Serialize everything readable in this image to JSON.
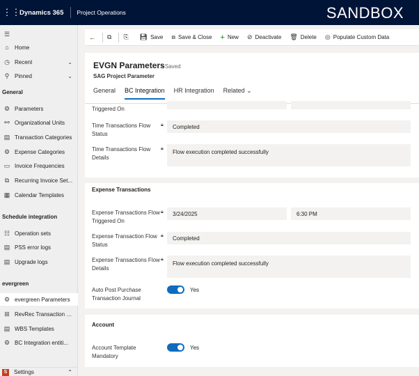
{
  "topbar": {
    "app_name": "Dynamics 365",
    "area": "Project Operations",
    "env": "SANDBOX"
  },
  "sidebar": {
    "nav": [
      {
        "label": "Home",
        "icon": "home-icon"
      },
      {
        "label": "Recent",
        "icon": "clock-icon"
      },
      {
        "label": "Pinned",
        "icon": "pin-icon"
      }
    ],
    "groups": [
      {
        "title": "General",
        "items": [
          "Parameters",
          "Organizational Units",
          "Transaction Categories",
          "Expense Categories",
          "Invoice Frequencies",
          "Recurring Invoice Set...",
          "Calendar Templates"
        ]
      },
      {
        "title": "Schedule integration",
        "items": [
          "Operation sets",
          "PSS error logs",
          "Upgrade logs"
        ]
      },
      {
        "title": "evergreen",
        "items": [
          "evergreen Parameters",
          "RevRec Transaction C...",
          "WBS Templates",
          "BC Integration entiti..."
        ]
      }
    ],
    "settings": {
      "badge": "S",
      "label": "Settings"
    }
  },
  "commands": [
    "Save",
    "Save & Close",
    "New",
    "Deactivate",
    "Delete",
    "Populate Custom Data"
  ],
  "header": {
    "title": "EVGN Parameters",
    "status": "- Saved",
    "subtitle": "SAG Project Parameter",
    "tabs": [
      "General",
      "BC Integration",
      "HR Integration",
      "Related"
    ]
  },
  "time_section": {
    "partial_label": "Triggered On",
    "status_label": "Time Transactions Flow Status",
    "status_value": "Completed",
    "details_label": "Time Transactions Flow Details",
    "details_value": "Flow execution completed successfully"
  },
  "expense_section": {
    "title": "Expense Transactions",
    "triggered_label": "Expense Transactions Flow Triggered On",
    "date_value": "3/24/2025",
    "time_value": "6:30 PM",
    "status_label": "Expense Transaction Flow Status",
    "status_value": "Completed",
    "details_label": "Expense Transactions Flow Details",
    "details_value": "Flow execution completed successfully",
    "auto_post_label": "Auto Post Purchase Transaction Journal",
    "auto_post_value": "Yes"
  },
  "account_section": {
    "title": "Account",
    "mandatory_label": "Account Template Mandatory",
    "mandatory_value": "Yes"
  },
  "colors": {
    "topbar": "#001437",
    "accent": "#0f6cbd",
    "field_bg": "#f3f2f1"
  }
}
